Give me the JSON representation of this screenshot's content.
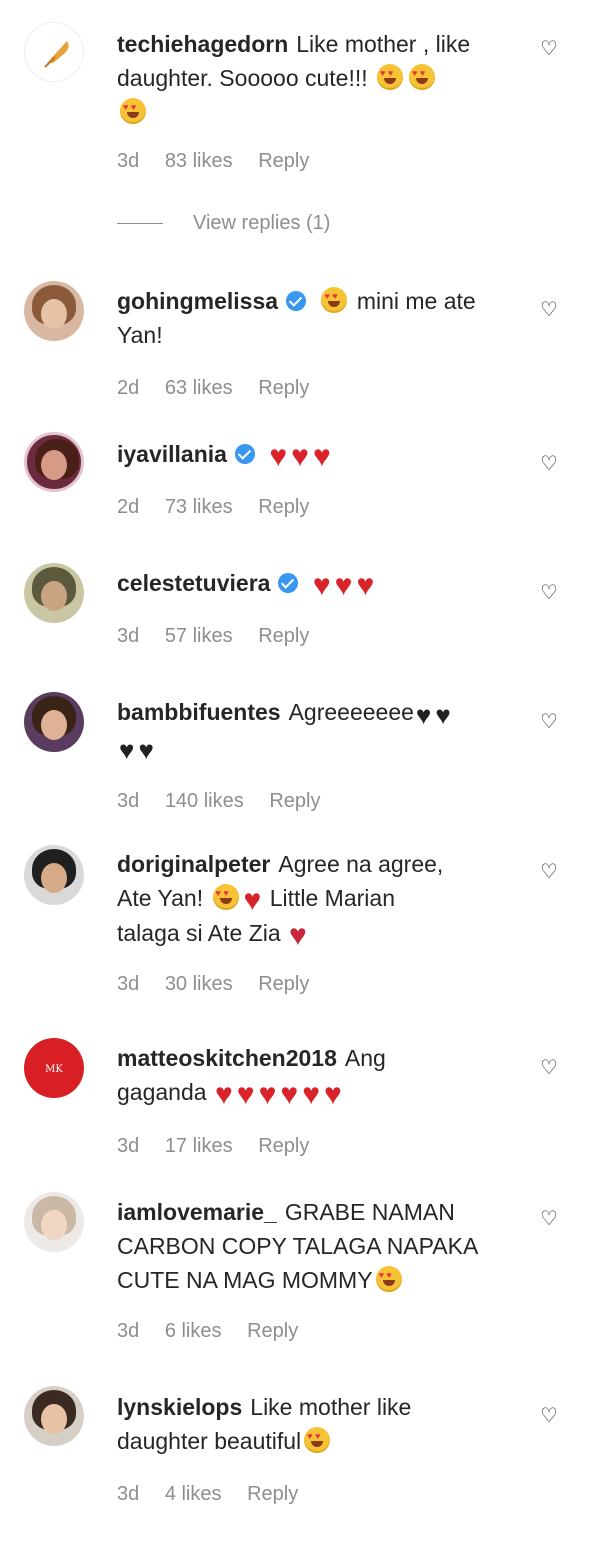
{
  "comments": [
    {
      "username": "techiehagedorn",
      "verified": false,
      "text_parts": [
        "Like mother , like",
        "daughter. Sooooo cute!!!"
      ],
      "emojis": "🥰🥰🥰",
      "time": "3d",
      "likes": "83 likes",
      "reply": "Reply"
    },
    {
      "username": "gohingmelissa",
      "verified": true,
      "text_parts": [
        "mini me ate",
        "Yan!"
      ],
      "emojis": "😍",
      "time": "2d",
      "likes": "63 likes",
      "reply": "Reply"
    },
    {
      "username": "iyavillania",
      "verified": true,
      "emojis": "❤️❤️❤️",
      "time": "2d",
      "likes": "73 likes",
      "reply": "Reply"
    },
    {
      "username": "celestetuviera",
      "verified": true,
      "emojis": "❤️❤️❤️",
      "time": "3d",
      "likes": "57 likes",
      "reply": "Reply"
    },
    {
      "username": "bambbifuentes",
      "verified": false,
      "text_parts": [
        "Agreeeeeee"
      ],
      "emojis": "🖤🖤🖤🖤",
      "time": "3d",
      "likes": "140 likes",
      "reply": "Reply"
    },
    {
      "username": "doriginalpeter",
      "verified": false,
      "text_parts": [
        "Agree na agree,",
        "Ate Yan!",
        "Little Marian",
        "talaga si Ate Zia"
      ],
      "emojis": "😍❤️💔",
      "time": "3d",
      "likes": "30 likes",
      "reply": "Reply"
    },
    {
      "username": "matteoskitchen2018",
      "verified": false,
      "text_parts": [
        "Ang",
        "gaganda"
      ],
      "emojis": "❤️❤️❤️❤️❤️❤️",
      "time": "3d",
      "likes": "17 likes",
      "reply": "Reply"
    },
    {
      "username": "iamlovemarie_",
      "verified": false,
      "text_parts": [
        "GRABE NAMAN",
        "CARBON COPY TALAGA NAPAKA",
        "CUTE NA MAG MOMMY"
      ],
      "emojis": "😍",
      "time": "3d",
      "likes": "6 likes",
      "reply": "Reply"
    },
    {
      "username": "lynskielops",
      "verified": false,
      "text_parts": [
        "Like mother like",
        "daughter beautiful"
      ],
      "emojis": "😍",
      "time": "3d",
      "likes": "4 likes",
      "reply": "Reply"
    }
  ],
  "view_replies": "View replies (1)",
  "icons": {
    "like": "heart-outline-icon",
    "verified": "verified-badge-icon"
  },
  "colors": {
    "verified": "#3897f0",
    "meta": "#8e8e8e",
    "heart": "#d8232a"
  }
}
